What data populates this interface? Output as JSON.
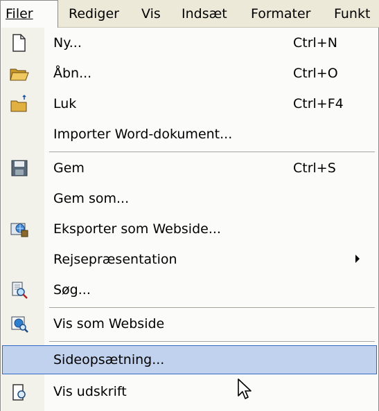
{
  "menubar": {
    "items": [
      {
        "label": "Filer",
        "underline_index": 0
      },
      {
        "label": "Rediger",
        "underline_index": 0
      },
      {
        "label": "Vis",
        "underline_index": 0
      },
      {
        "label": "Indsæt",
        "underline_index": 0
      },
      {
        "label": "Formater",
        "underline_index": 5
      },
      {
        "label": "Funkt",
        "underline_index": 3
      }
    ]
  },
  "dropdown": {
    "items": [
      {
        "label": "Ny...",
        "shortcut": "Ctrl+N",
        "icon": "new-document-icon"
      },
      {
        "label": "Åbn...",
        "shortcut": "Ctrl+O",
        "icon": "open-folder-icon"
      },
      {
        "label": "Luk",
        "shortcut": "Ctrl+F4",
        "icon": "close-folder-icon"
      },
      {
        "label": "Importer Word-dokument...",
        "shortcut": "",
        "icon": ""
      },
      {
        "label": "Gem",
        "shortcut": "Ctrl+S",
        "icon": "save-disk-icon"
      },
      {
        "label": "Gem som...",
        "shortcut": "",
        "icon": ""
      },
      {
        "label": "Eksporter som Webside...",
        "shortcut": "",
        "icon": "export-web-icon"
      },
      {
        "label": "Rejsepræsentation",
        "shortcut": "",
        "icon": "",
        "submenu": true
      },
      {
        "label": "Søg...",
        "shortcut": "",
        "icon": "search-document-icon"
      },
      {
        "label": "Vis som Webside",
        "shortcut": "",
        "icon": "web-preview-icon"
      },
      {
        "label": "Sideopsætning...",
        "shortcut": "",
        "icon": "",
        "highlighted": true
      },
      {
        "label": "Vis udskrift",
        "shortcut": "",
        "icon": "print-preview-icon"
      }
    ]
  },
  "colors": {
    "menubar_bg": "#ece9d8",
    "menu_bg": "#fbfbf9",
    "gutter_bg": "#f2f1ea",
    "highlight_bg": "#c1d2ee",
    "highlight_border": "#316ac5"
  }
}
